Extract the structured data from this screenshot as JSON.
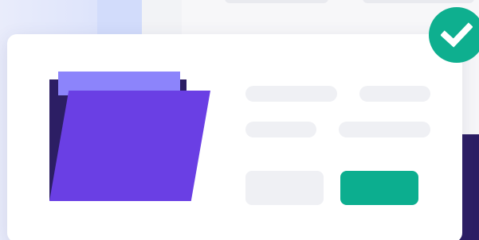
{
  "illustration": {
    "icons": {
      "folder": "folder-icon",
      "check": "check-circle-icon"
    },
    "colors": {
      "background_left": "#dfe5fb",
      "card": "#ffffff",
      "folder_front": "#6a3fe4",
      "folder_tab": "#8c84fb",
      "folder_back": "#2c1e64",
      "placeholder": "#eff0f4",
      "accent_green": "#0cae8f"
    },
    "buttons": {
      "secondary_label": "",
      "primary_label": ""
    }
  }
}
